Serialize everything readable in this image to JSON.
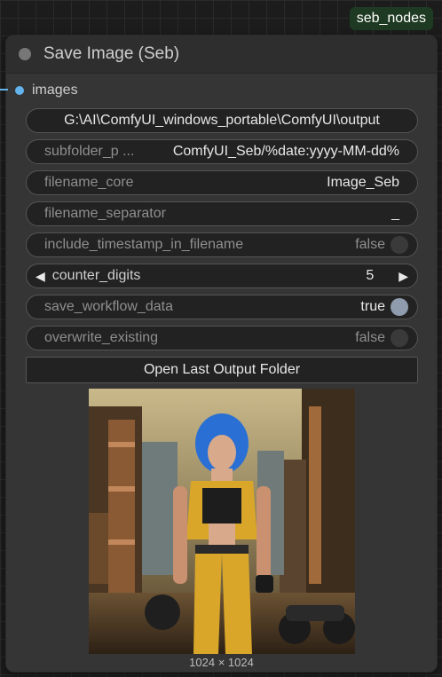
{
  "badge": "seb_nodes",
  "node": {
    "title": "Save Image (Seb)",
    "input_label": "images"
  },
  "widgets": {
    "output_path": "G:\\AI\\ComfyUI_windows_portable\\ComfyUI\\output",
    "subfolder_label": "subfolder_p ...",
    "subfolder_value": "ComfyUI_Seb/%date:yyyy-MM-dd%",
    "filename_core_label": "filename_core",
    "filename_core_value": "Image_Seb",
    "filename_separator_label": "filename_separator",
    "filename_separator_value": "_",
    "include_timestamp_label": "include_timestamp_in_filename",
    "include_timestamp_value": "false",
    "counter_digits_label": "counter_digits",
    "counter_digits_value": "5",
    "save_workflow_label": "save_workflow_data",
    "save_workflow_value": "true",
    "overwrite_label": "overwrite_existing",
    "overwrite_value": "false"
  },
  "button": {
    "open_folder": "Open Last Output Folder"
  },
  "preview": {
    "dimensions": "1024 × 1024"
  },
  "colors": {
    "accent_blue": "#63b3ed",
    "badge_green": "#1f3a22",
    "node_bg": "#353535",
    "widget_bg": "#222222"
  },
  "icons": [
    "collapse-dot-icon",
    "arrow-left-icon",
    "arrow-right-icon",
    "toggle-icon"
  ]
}
